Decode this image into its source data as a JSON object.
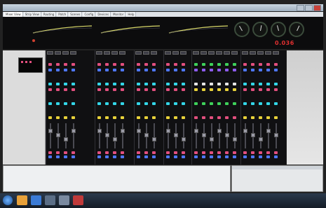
{
  "window": {
    "title": ""
  },
  "tabs": [
    {
      "label": "Mixer View"
    },
    {
      "label": "Strip View"
    },
    {
      "label": "Routing"
    },
    {
      "label": "Patch"
    },
    {
      "label": "Scenes"
    },
    {
      "label": "Config"
    },
    {
      "label": "Devices"
    },
    {
      "label": "Monitor"
    },
    {
      "label": "Help"
    }
  ],
  "meters": {
    "title": "",
    "gauges": [
      "",
      "",
      "",
      ""
    ],
    "readout": "0.036",
    "readout_label": "",
    "status_label": ""
  },
  "left_panel": {
    "rows": [
      "",
      "",
      "",
      ""
    ]
  },
  "console": {
    "lines": [
      "",
      "",
      "",
      ""
    ]
  },
  "side_pane": {
    "headers": [
      "",
      ""
    ]
  },
  "taskbar": {
    "clock": ""
  },
  "colors": {
    "pink": "#e24f7e",
    "blue": "#4f78ff",
    "cyan": "#33d6e8",
    "yellow": "#e8d23a",
    "green": "#3ed15a",
    "red": "#e03030",
    "white": "#e6e6e6",
    "purple": "#8e5cf0"
  }
}
